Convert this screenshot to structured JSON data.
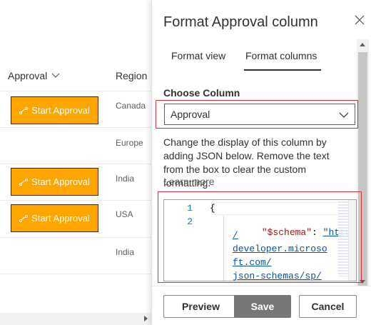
{
  "list": {
    "headers": {
      "approval": "Approval",
      "region": "Region"
    },
    "rows": [
      {
        "button": "Start Approval",
        "region": "Canada"
      },
      {
        "button": "",
        "region": "Europe"
      },
      {
        "button": "Start Approval",
        "region": "India"
      },
      {
        "button": "Start Approval",
        "region": "USA"
      },
      {
        "button": "",
        "region": "India"
      }
    ]
  },
  "panel": {
    "title": "Format Approval column",
    "tabs": [
      {
        "label": "Format view",
        "selected": false
      },
      {
        "label": "Format columns",
        "selected": true
      }
    ],
    "choose_label": "Choose Column",
    "selected_column": "Approval",
    "description": "Change the display of this column by adding JSON below. Remove the text from the box to clear the custom formatting.",
    "learn_more": "Learn more",
    "editor": {
      "line_numbers": [
        "1",
        "2"
      ],
      "line1": "{",
      "key": "\"$schema\"",
      "colon": ": ",
      "url_parts": [
        "\"https:/",
        "/",
        "developer.microso",
        "ft.com/",
        "json-schemas/sp/"
      ]
    },
    "buttons": {
      "preview": "Preview",
      "save": "Save",
      "cancel": "Cancel"
    }
  },
  "colors": {
    "approval_button": "#ffa500",
    "highlight_border": "#d13438",
    "save_button": "#797775"
  }
}
